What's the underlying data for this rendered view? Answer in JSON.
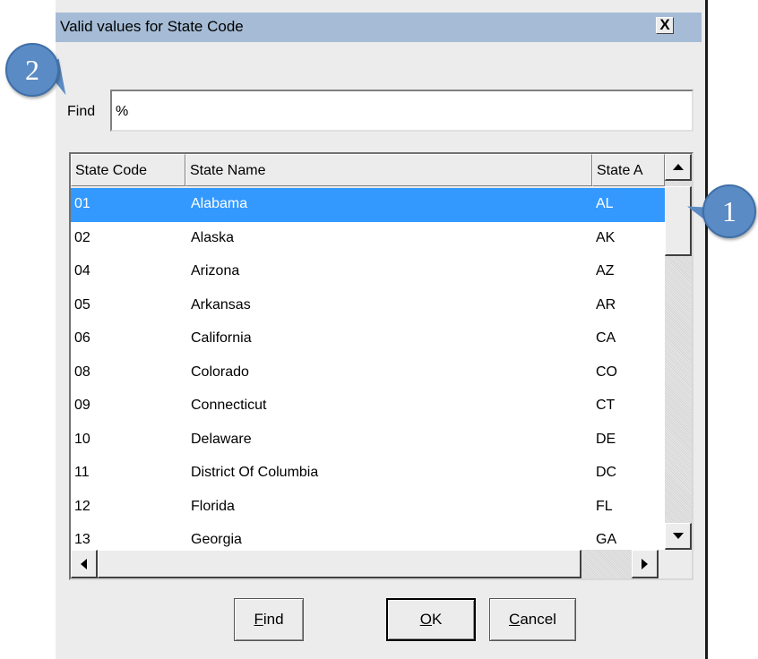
{
  "dialog": {
    "title": "Valid values for State Code",
    "close_symbol": "X"
  },
  "find": {
    "label": "Find",
    "value": "%"
  },
  "table": {
    "columns": [
      "State Code",
      "State Name",
      "State A"
    ],
    "rows": [
      {
        "code": "01",
        "name": "Alabama",
        "abbr": "AL",
        "selected": true
      },
      {
        "code": "02",
        "name": "Alaska",
        "abbr": "AK"
      },
      {
        "code": "04",
        "name": "Arizona",
        "abbr": "AZ"
      },
      {
        "code": "05",
        "name": "Arkansas",
        "abbr": "AR"
      },
      {
        "code": "06",
        "name": "California",
        "abbr": "CA"
      },
      {
        "code": "08",
        "name": "Colorado",
        "abbr": "CO"
      },
      {
        "code": "09",
        "name": "Connecticut",
        "abbr": "CT"
      },
      {
        "code": "10",
        "name": "Delaware",
        "abbr": "DE"
      },
      {
        "code": "11",
        "name": "District Of Columbia",
        "abbr": "DC"
      },
      {
        "code": "12",
        "name": "Florida",
        "abbr": "FL"
      },
      {
        "code": "13",
        "name": "Georgia",
        "abbr": "GA"
      }
    ]
  },
  "buttons": {
    "find": {
      "mnemonic": "F",
      "rest": "ind"
    },
    "ok": {
      "mnemonic": "O",
      "rest": "K"
    },
    "cancel": {
      "mnemonic": "C",
      "rest": "ancel"
    }
  },
  "callouts": {
    "one": "1",
    "two": "2"
  },
  "colors": {
    "titlebar": "#a6bcd6",
    "selection": "#3399ff",
    "callout": "#5b8bc4"
  }
}
